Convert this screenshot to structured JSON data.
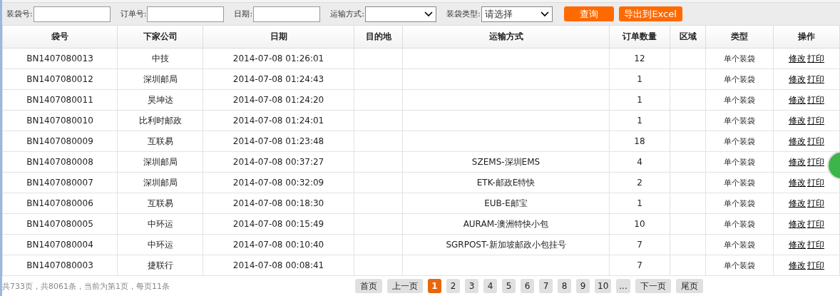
{
  "filters": [
    {
      "kind": "input",
      "label": "装袋号:"
    },
    {
      "kind": "input",
      "label": "订单号:"
    },
    {
      "kind": "input",
      "label": "日期:"
    },
    {
      "kind": "select",
      "label": "运输方式:"
    },
    {
      "kind": "select",
      "label": "装袋类型:",
      "value": "请选择"
    }
  ],
  "buttons": [
    "查询",
    "导出到Excel"
  ],
  "table": {
    "columns": [
      "袋号",
      "下家公司",
      "日期",
      "目的地",
      "运输方式",
      "订单数量",
      "区域",
      "类型",
      "操作"
    ],
    "rows": [
      {
        "cells": [
          "BN1407080013",
          "中技",
          "2014-07-08 01:26:01",
          "",
          "",
          "12",
          "",
          "单个装袋"
        ],
        "actions": [
          "修改",
          "打印"
        ]
      },
      {
        "cells": [
          "BN1407080012",
          "深圳邮局",
          "2014-07-08 01:24:43",
          "",
          "",
          "1",
          "",
          "单个装袋"
        ],
        "actions": [
          "修改",
          "打印"
        ]
      },
      {
        "cells": [
          "BN1407080011",
          "昊坤达",
          "2014-07-08 01:24:20",
          "",
          "",
          "1",
          "",
          "单个装袋"
        ],
        "actions": [
          "修改",
          "打印"
        ]
      },
      {
        "cells": [
          "BN1407080010",
          "比利时邮政",
          "2014-07-08 01:24:01",
          "",
          "",
          "1",
          "",
          "单个装袋"
        ],
        "actions": [
          "修改",
          "打印"
        ]
      },
      {
        "cells": [
          "BN1407080009",
          "互联易",
          "2014-07-08 01:23:48",
          "",
          "",
          "18",
          "",
          "单个装袋"
        ],
        "actions": [
          "修改",
          "打印"
        ]
      },
      {
        "cells": [
          "BN1407080008",
          "深圳邮局",
          "2014-07-08 00:37:27",
          "",
          "SZEMS-深圳EMS",
          "4",
          "",
          "单个装袋"
        ],
        "actions": [
          "修改",
          "打印"
        ]
      },
      {
        "cells": [
          "BN1407080007",
          "深圳邮局",
          "2014-07-08 00:32:09",
          "",
          "ETK-邮政E特快",
          "2",
          "",
          "单个装袋"
        ],
        "actions": [
          "修改",
          "打印"
        ]
      },
      {
        "cells": [
          "BN1407080006",
          "互联易",
          "2014-07-08 00:18:30",
          "",
          "EUB-E邮宝",
          "1",
          "",
          "单个装袋"
        ],
        "actions": [
          "修改",
          "打印"
        ]
      },
      {
        "cells": [
          "BN1407080005",
          "中环运",
          "2014-07-08 00:15:49",
          "",
          "AURAM-澳洲特快小包",
          "10",
          "",
          "单个装袋"
        ],
        "actions": [
          "修改",
          "打印"
        ]
      },
      {
        "cells": [
          "BN1407080004",
          "中环运",
          "2014-07-08 00:10:40",
          "",
          "SGRPOST-新加坡邮政小包挂号",
          "7",
          "",
          "单个装袋"
        ],
        "actions": [
          "修改",
          "打印"
        ]
      },
      {
        "cells": [
          "BN1407080003",
          "捷联行",
          "2014-07-08 00:08:41",
          "",
          "",
          "7",
          "",
          "单个装袋"
        ],
        "actions": [
          "修改",
          "打印"
        ]
      }
    ]
  },
  "pagination": {
    "summary": "共733页，共8061条，当前为第1页，每页11条",
    "first": "首页",
    "prev": "上一页",
    "pages": [
      {
        "label": "1",
        "selected": true
      },
      {
        "label": "2",
        "selected": false
      },
      {
        "label": "3",
        "selected": false
      },
      {
        "label": "4",
        "selected": false
      },
      {
        "label": "5",
        "selected": false
      },
      {
        "label": "6",
        "selected": false
      },
      {
        "label": "7",
        "selected": false
      },
      {
        "label": "8",
        "selected": false
      },
      {
        "label": "9",
        "selected": false
      },
      {
        "label": "10",
        "selected": false
      },
      {
        "label": "...",
        "selected": false
      }
    ],
    "next": "下一页",
    "last": "尾页"
  }
}
